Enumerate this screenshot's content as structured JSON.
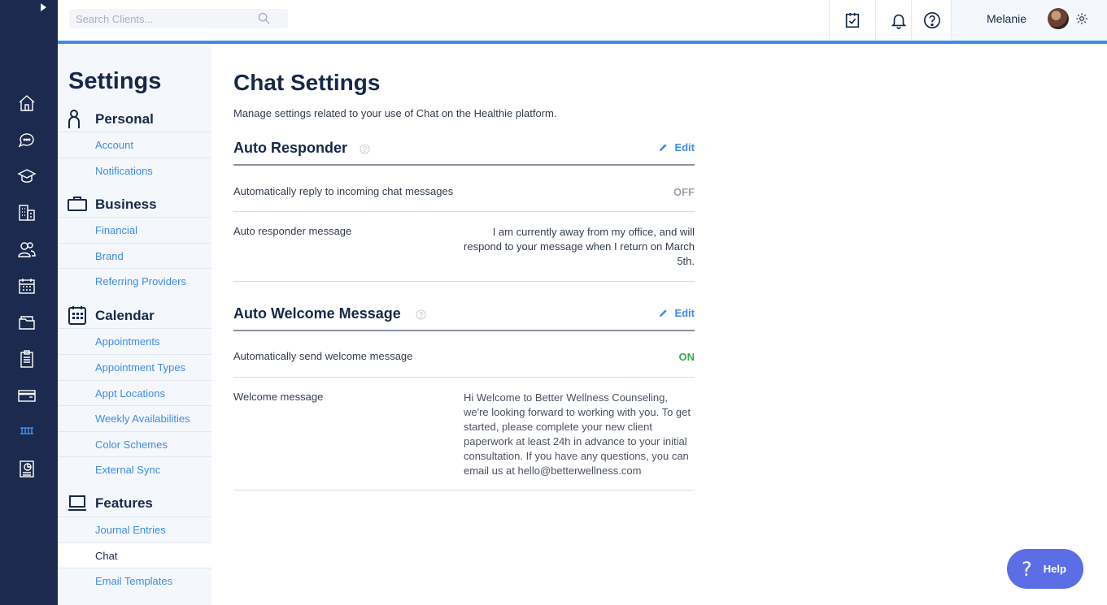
{
  "search": {
    "placeholder": "Search Clients..."
  },
  "user": {
    "name": "Melanie"
  },
  "colors": {
    "rail": "#1b2a4e",
    "accent": "#3d8ce6",
    "on": "#3aa84a",
    "help": "#5c6ee6"
  },
  "rail_icons": [
    "home-icon",
    "chat-icon",
    "graduation-cap-icon",
    "building-icon",
    "clients-icon",
    "calendar-icon",
    "folders-icon",
    "clipboard-icon",
    "billing-card-icon",
    "supplements-icon",
    "reports-icon"
  ],
  "sidebar": {
    "title": "Settings",
    "sections": [
      {
        "label": "Personal",
        "icon": "person-icon",
        "items": [
          "Account",
          "Notifications"
        ]
      },
      {
        "label": "Business",
        "icon": "briefcase-icon",
        "items": [
          "Financial",
          "Brand",
          "Referring Providers"
        ]
      },
      {
        "label": "Calendar",
        "icon": "calendar-icon",
        "items": [
          "Appointments",
          "Appointment Types",
          "Appt Locations",
          "Weekly Availabilities",
          "Color Schemes",
          "External Sync"
        ]
      },
      {
        "label": "Features",
        "icon": "laptop-icon",
        "items": [
          "Journal Entries",
          "Chat",
          "Email Templates"
        ]
      }
    ],
    "active_item": "Chat"
  },
  "main": {
    "title": "Chat Settings",
    "description": "Manage settings related to your use of Chat on the Healthie platform.",
    "auto_responder": {
      "heading": "Auto Responder",
      "edit_label": "Edit",
      "toggle_label": "Automatically reply to incoming chat messages",
      "toggle_value": "OFF",
      "message_label": "Auto responder message",
      "message_value": "I am currently away from my office, and will respond to your message when I return on March 5th."
    },
    "auto_welcome": {
      "heading": "Auto Welcome Message",
      "edit_label": "Edit",
      "toggle_label": "Automatically send welcome message",
      "toggle_value": "ON",
      "message_label": "Welcome message",
      "message_value": "Hi Welcome to Better Wellness Counseling, we're looking forward to working with you. To get started, please complete your new client paperwork at least 24h in advance to your initial consultation. If you have any questions, you can email us at hello@betterwellness.com"
    }
  },
  "help_button": {
    "label": "Help"
  }
}
